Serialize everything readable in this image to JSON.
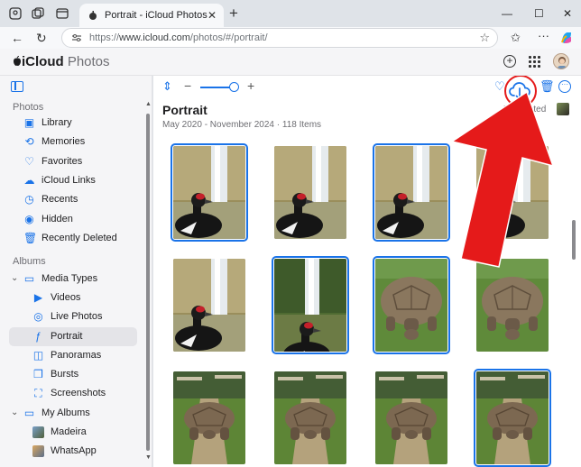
{
  "browser": {
    "tab_title": "Portrait - iCloud Photos",
    "url_scheme": "https://",
    "url_host": "www.icloud.com",
    "url_path": "/photos/#/portrait/"
  },
  "app": {
    "brand": "iCloud",
    "product": "Photos"
  },
  "sidebar": {
    "sections": {
      "photos": "Photos",
      "albums": "Albums"
    },
    "items": [
      {
        "label": "Library",
        "icon": "library-icon"
      },
      {
        "label": "Memories",
        "icon": "memories-icon"
      },
      {
        "label": "Favorites",
        "icon": "heart-icon"
      },
      {
        "label": "iCloud Links",
        "icon": "link-icon"
      },
      {
        "label": "Recents",
        "icon": "clock-icon"
      },
      {
        "label": "Hidden",
        "icon": "eye-slash-icon"
      },
      {
        "label": "Recently Deleted",
        "icon": "trash-icon"
      },
      {
        "label": "Media Types",
        "icon": "folder-icon"
      },
      {
        "label": "Videos",
        "icon": "video-icon"
      },
      {
        "label": "Live Photos",
        "icon": "live-photo-icon"
      },
      {
        "label": "Portrait",
        "icon": "aperture-icon"
      },
      {
        "label": "Panoramas",
        "icon": "panorama-icon"
      },
      {
        "label": "Bursts",
        "icon": "bursts-icon"
      },
      {
        "label": "Screenshots",
        "icon": "screenshot-icon"
      },
      {
        "label": "My Albums",
        "icon": "folder-icon"
      },
      {
        "label": "Madeira",
        "icon": "album-thumb"
      },
      {
        "label": "WhatsApp",
        "icon": "album-thumb"
      }
    ],
    "active": "Portrait"
  },
  "main": {
    "title": "Portrait",
    "date_range": "May 2020 - November 2024",
    "separator": "·",
    "item_count": "118 Items",
    "selected_label": "5 Selected"
  },
  "photos": [
    {
      "subject": "duck",
      "selected": true
    },
    {
      "subject": "duck",
      "selected": false
    },
    {
      "subject": "duck",
      "selected": true
    },
    {
      "subject": "duck",
      "selected": false
    },
    {
      "subject": "duck",
      "selected": false
    },
    {
      "subject": "waterfall-duck",
      "selected": true
    },
    {
      "subject": "tortoise",
      "selected": true
    },
    {
      "subject": "tortoise",
      "selected": false
    },
    {
      "subject": "tortoise-path",
      "selected": false
    },
    {
      "subject": "tortoise-path",
      "selected": false
    },
    {
      "subject": "tortoise-path",
      "selected": false
    },
    {
      "subject": "tortoise-path",
      "selected": true
    }
  ],
  "colors": {
    "accent": "#1a73e8",
    "annotation_red": "#e51a1a"
  }
}
